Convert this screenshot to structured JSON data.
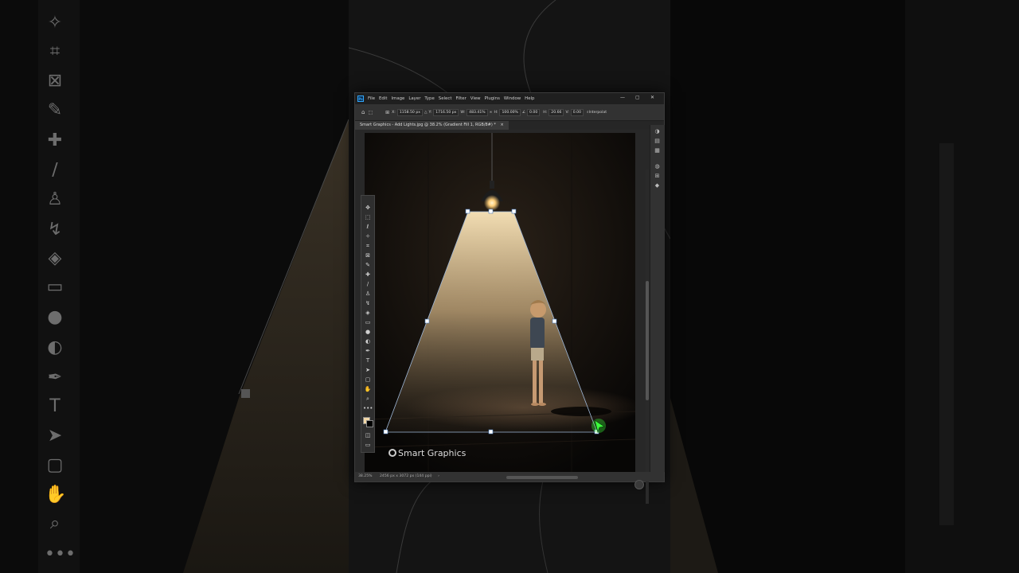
{
  "window": {
    "app_logo": "Ps",
    "menus": [
      "File",
      "Edit",
      "Image",
      "Layer",
      "Type",
      "Select",
      "Filter",
      "View",
      "Plugins",
      "Window",
      "Help"
    ]
  },
  "options_bar": {
    "x_label": "X:",
    "x_value": "1158.50 px",
    "y_label": "Y:",
    "y_value": "1716.50 px",
    "w_label": "W:",
    "w_value": "483.41%",
    "h_label": "H:",
    "h_value": "100.00%",
    "rotate_value": "0.00",
    "h_skew_label": "H:",
    "h_skew_value": "20.66",
    "v_skew_label": "V:",
    "v_skew_value": "0.00",
    "interpolation": "Interpolat"
  },
  "document": {
    "tab_title": "Smart Graphics - Add Lights.jpg @ 38.2% (Gradient Fill 1, RGB/8#) *"
  },
  "status": {
    "zoom": "38.25%",
    "doc_size": "2456 px x 3072 px (144 ppi)"
  },
  "watermark": {
    "text": "Smart Graphics",
    "icon": "smart-graphics-logo-icon"
  },
  "colors": {
    "foreground_swatch": "#f2d8a8",
    "background_swatch": "#000000",
    "transform_handle_active": "#3cff3c",
    "light_beam": "#f3dcaf"
  },
  "icons": [
    "move-icon",
    "marquee-icon",
    "lasso-icon",
    "magic-wand-icon",
    "crop-icon",
    "frame-icon",
    "eyedropper-icon",
    "healing-icon",
    "brush-icon",
    "stamp-icon",
    "history-brush-icon",
    "eraser-icon",
    "gradient-icon",
    "blur-icon",
    "dodge-icon",
    "pen-icon",
    "type-icon",
    "path-select-icon",
    "shape-icon",
    "hand-icon",
    "zoom-icon",
    "more-icon"
  ]
}
